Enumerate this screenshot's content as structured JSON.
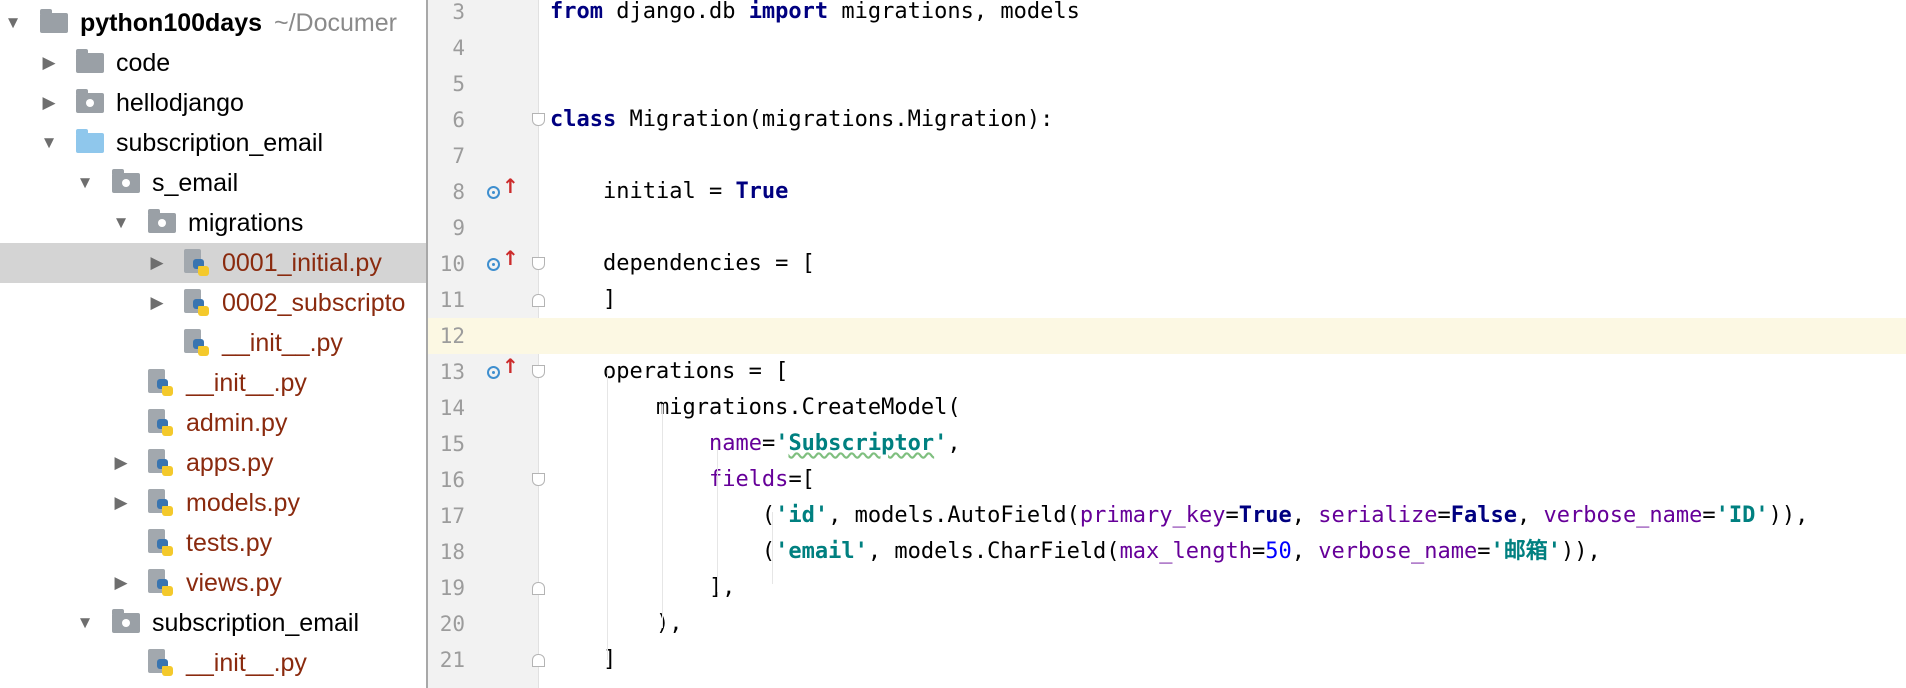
{
  "project_tree": {
    "root": {
      "name": "python100days",
      "path": "~/Documer"
    },
    "items": [
      {
        "label": "code",
        "kind": "folder"
      },
      {
        "label": "hellodjango",
        "kind": "folder"
      },
      {
        "label": "subscription_email",
        "kind": "folder"
      },
      {
        "label": "s_email",
        "kind": "folder"
      },
      {
        "label": "migrations",
        "kind": "folder"
      },
      {
        "label": "0001_initial.py",
        "kind": "file"
      },
      {
        "label": "0002_subscripto",
        "kind": "file"
      },
      {
        "label": "__init__.py",
        "kind": "file"
      },
      {
        "label": "__init__.py",
        "kind": "file"
      },
      {
        "label": "admin.py",
        "kind": "file"
      },
      {
        "label": "apps.py",
        "kind": "file"
      },
      {
        "label": "models.py",
        "kind": "file"
      },
      {
        "label": "tests.py",
        "kind": "file"
      },
      {
        "label": "views.py",
        "kind": "file"
      },
      {
        "label": "subscription_email",
        "kind": "folder"
      },
      {
        "label": "__init__.py",
        "kind": "file"
      }
    ],
    "selected_item": "0001_initial.py"
  },
  "editor": {
    "current_line": 12,
    "lines": [
      {
        "n": "3",
        "tokens": [
          [
            "kw",
            "from"
          ],
          [
            "tx",
            " django.db "
          ],
          [
            "kw",
            "import"
          ],
          [
            "tx",
            " migrations, models"
          ]
        ]
      },
      {
        "n": "4",
        "tokens": []
      },
      {
        "n": "5",
        "tokens": []
      },
      {
        "n": "6",
        "tokens": [
          [
            "kw",
            "class"
          ],
          [
            "tx",
            " Migration(migrations.Migration):"
          ]
        ]
      },
      {
        "n": "7",
        "tokens": []
      },
      {
        "n": "8",
        "tokens": [
          [
            "tx",
            "    initial = "
          ],
          [
            "kw",
            "True"
          ]
        ]
      },
      {
        "n": "9",
        "tokens": []
      },
      {
        "n": "10",
        "tokens": [
          [
            "tx",
            "    dependencies = ["
          ]
        ]
      },
      {
        "n": "11",
        "tokens": [
          [
            "tx",
            "    ]"
          ]
        ]
      },
      {
        "n": "12",
        "tokens": []
      },
      {
        "n": "13",
        "tokens": [
          [
            "tx",
            "    operations = ["
          ]
        ]
      },
      {
        "n": "14",
        "tokens": [
          [
            "tx",
            "        migrations.CreateModel("
          ]
        ]
      },
      {
        "n": "15",
        "tokens": [
          [
            "tx",
            "            "
          ],
          [
            "pr",
            "name"
          ],
          [
            "tx",
            "="
          ],
          [
            "st",
            "'"
          ],
          [
            "stw",
            "Subscriptor"
          ],
          [
            "st",
            "'"
          ],
          [
            "tx",
            ","
          ]
        ]
      },
      {
        "n": "16",
        "tokens": [
          [
            "tx",
            "            "
          ],
          [
            "pr",
            "fields"
          ],
          [
            "tx",
            "=["
          ]
        ]
      },
      {
        "n": "17",
        "tokens": [
          [
            "tx",
            "                ("
          ],
          [
            "st",
            "'id'"
          ],
          [
            "tx",
            ", models.AutoField("
          ],
          [
            "pr",
            "primary_key"
          ],
          [
            "tx",
            "="
          ],
          [
            "kw",
            "True"
          ],
          [
            "tx",
            ", "
          ],
          [
            "pr",
            "serialize"
          ],
          [
            "tx",
            "="
          ],
          [
            "kw",
            "False"
          ],
          [
            "tx",
            ", "
          ],
          [
            "pr",
            "verbose_name"
          ],
          [
            "tx",
            "="
          ],
          [
            "st",
            "'ID'"
          ],
          [
            "tx",
            ")),"
          ]
        ]
      },
      {
        "n": "18",
        "tokens": [
          [
            "tx",
            "                ("
          ],
          [
            "st",
            "'email'"
          ],
          [
            "tx",
            ", models.CharField("
          ],
          [
            "pr",
            "max_length"
          ],
          [
            "tx",
            "="
          ],
          [
            "nu",
            "50"
          ],
          [
            "tx",
            ", "
          ],
          [
            "pr",
            "verbose_name"
          ],
          [
            "tx",
            "="
          ],
          [
            "st",
            "'邮箱'"
          ],
          [
            "tx",
            ")),"
          ]
        ]
      },
      {
        "n": "19",
        "tokens": [
          [
            "tx",
            "            ],"
          ]
        ]
      },
      {
        "n": "20",
        "tokens": [
          [
            "tx",
            "        ),"
          ]
        ]
      },
      {
        "n": "21",
        "tokens": [
          [
            "tx",
            "    ]"
          ]
        ]
      }
    ],
    "gutter_markers": [
      {
        "line": "8",
        "icon": "override-up-arrow-icon"
      },
      {
        "line": "10",
        "icon": "override-up-arrow-icon"
      },
      {
        "line": "13",
        "icon": "override-up-arrow-icon"
      }
    ]
  }
}
